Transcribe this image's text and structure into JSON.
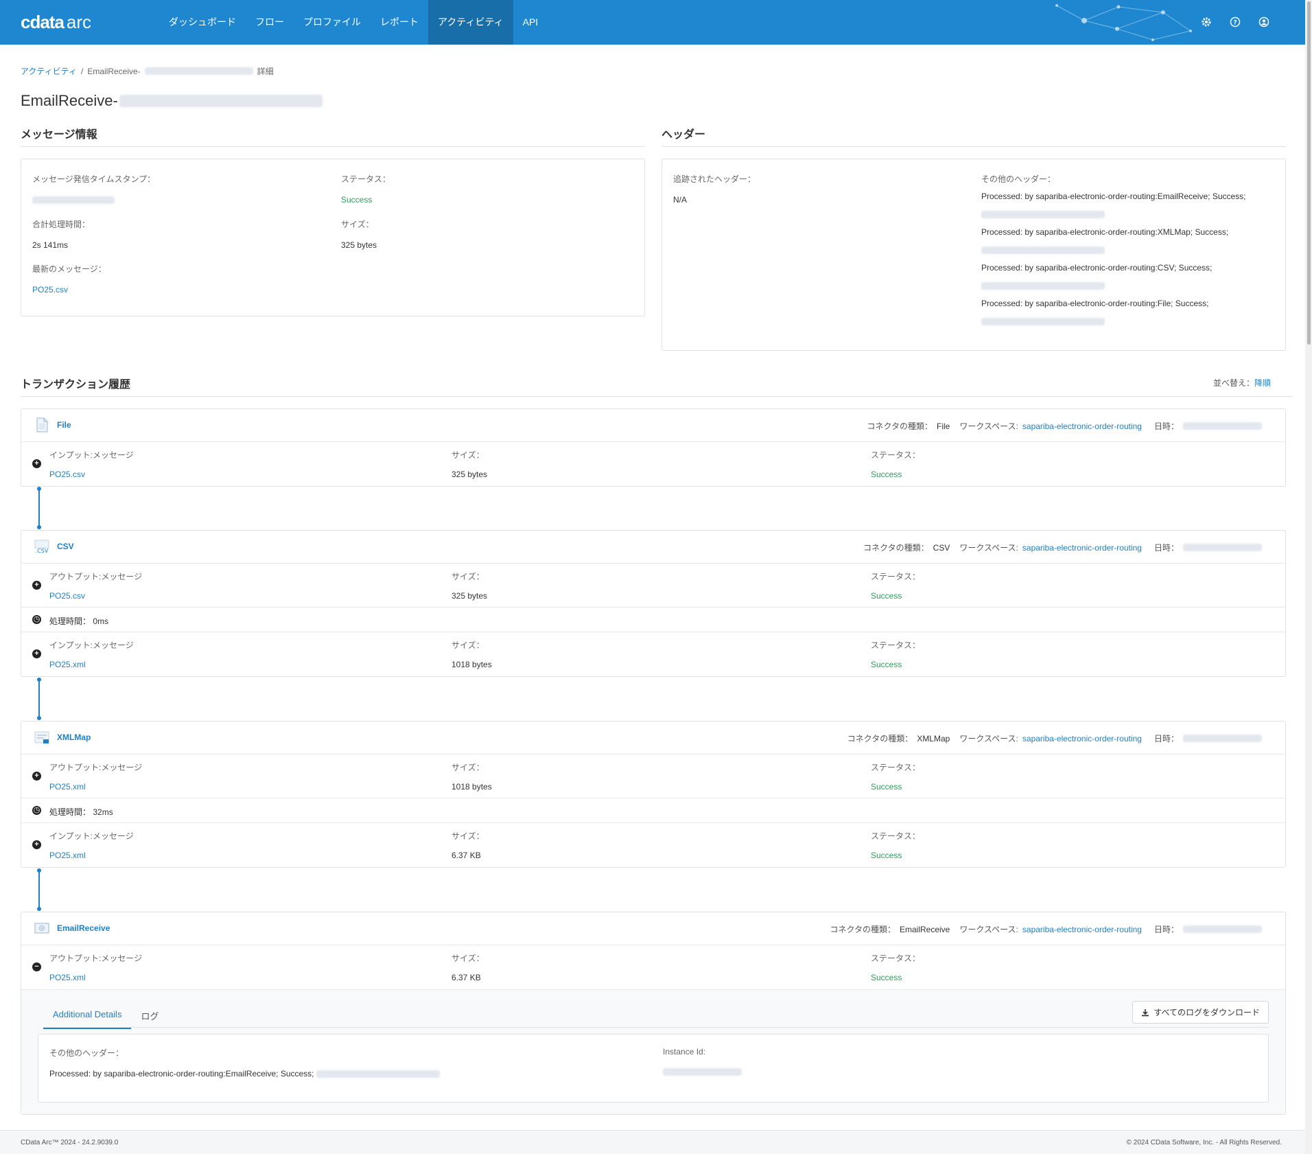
{
  "app": {
    "logo": "cdata",
    "logo_suffix": "arc"
  },
  "nav": [
    {
      "label": "ダッシュボード",
      "active": false
    },
    {
      "label": "フロー",
      "active": false
    },
    {
      "label": "プロファイル",
      "active": false
    },
    {
      "label": "レポート",
      "active": false
    },
    {
      "label": "アクティビティ",
      "active": true
    },
    {
      "label": "API",
      "active": false
    }
  ],
  "header_icons": [
    "gear-icon",
    "help-icon",
    "user-icon"
  ],
  "breadcrumb": {
    "root": "アクティビティ",
    "sep": "/",
    "current": "EmailReceive-",
    "suffix": "詳細"
  },
  "page": {
    "title": "EmailReceive-"
  },
  "message_info": {
    "title": "メッセージ情報",
    "timestamp_label": "メッセージ発信タイムスタンプ：",
    "status_label": "ステータス：",
    "status_value": "Success",
    "total_time_label": "合計処理時間：",
    "total_time_value": "2s 141ms",
    "size_label": "サイズ：",
    "size_value": "325 bytes",
    "latest_label": "最新のメッセージ：",
    "latest_value": "PO25.csv"
  },
  "headers": {
    "title": "ヘッダー",
    "tracked_label": "追跡されたヘッダー：",
    "tracked_value": "N/A",
    "other_label": "その他のヘッダー：",
    "other": [
      "Processed: by sapariba-electronic-order-routing:EmailReceive; Success;",
      "Processed: by sapariba-electronic-order-routing:XMLMap; Success;",
      "Processed: by sapariba-electronic-order-routing:CSV; Success;",
      "Processed: by sapariba-electronic-order-routing:File; Success;"
    ]
  },
  "history": {
    "title": "トランザクション履歴",
    "sort_label": "並べ替え：",
    "sort_value": "降順"
  },
  "common": {
    "connector_type_label": "コネクタの種類：",
    "workspace_label": "ワークスペース:",
    "workspace_value": "sapariba-electronic-order-routing",
    "date_label": "日時：",
    "size_label": "サイズ：",
    "status_label": "ステータス：",
    "time_label": "処理時間：",
    "input_label": "インプット:メッセージ",
    "output_label": "アウトプット:メッセージ"
  },
  "transactions": [
    {
      "name": "File",
      "type": "File",
      "icon": "file-icon",
      "rows": [
        {
          "kind": "input",
          "file": "PO25.csv",
          "size": "325 bytes",
          "status": "Success"
        }
      ]
    },
    {
      "name": "CSV",
      "type": "CSV",
      "icon": "csv-icon",
      "rows": [
        {
          "kind": "output",
          "file": "PO25.csv",
          "size": "325 bytes",
          "status": "Success"
        },
        {
          "kind": "time",
          "value": "0ms"
        },
        {
          "kind": "input",
          "file": "PO25.xml",
          "size": "1018 bytes",
          "status": "Success"
        }
      ]
    },
    {
      "name": "XMLMap",
      "type": "XMLMap",
      "icon": "xmlmap-icon",
      "rows": [
        {
          "kind": "output",
          "file": "PO25.xml",
          "size": "1018 bytes",
          "status": "Success"
        },
        {
          "kind": "time",
          "value": "32ms"
        },
        {
          "kind": "input",
          "file": "PO25.xml",
          "size": "6.37 KB",
          "status": "Success"
        }
      ]
    },
    {
      "name": "EmailReceive",
      "type": "EmailReceive",
      "icon": "email-receive-icon",
      "rows": [
        {
          "kind": "output",
          "file": "PO25.xml",
          "size": "6.37 KB",
          "status": "Success"
        }
      ]
    }
  ],
  "details": {
    "tabs": [
      "Additional Details",
      "ログ"
    ],
    "download_label": "すべてのログをダウンロード",
    "other_headers_label": "その他のヘッダー：",
    "other_headers_value": "Processed: by sapariba-electronic-order-routing:EmailReceive; Success;",
    "instance_label": "Instance Id:"
  },
  "footer": {
    "left": "CData Arc™ 2024 - 24.2.9039.0",
    "right": "© 2024 CData Software, Inc. - All Rights Reserved."
  },
  "colors": {
    "header": "#1e87cf",
    "link": "#1f7fc7",
    "success": "#2e9e5b"
  }
}
